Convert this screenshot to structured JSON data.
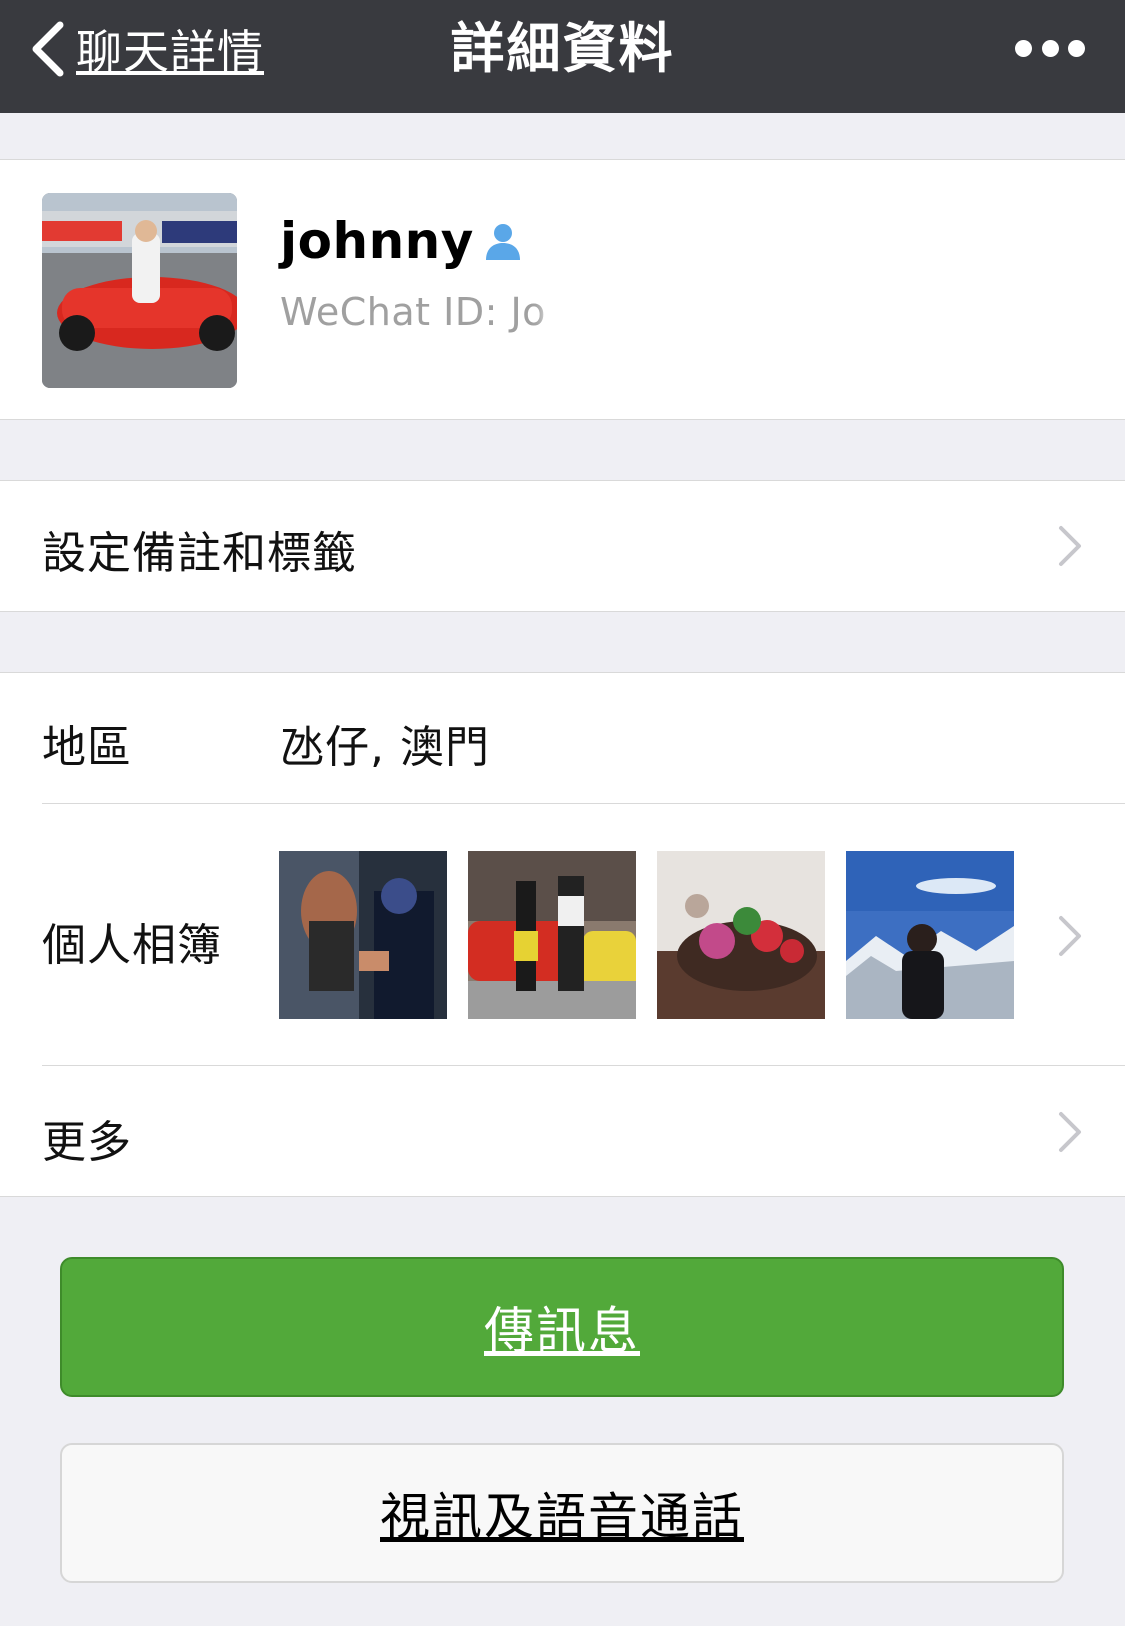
{
  "nav": {
    "back_label": "聊天詳情",
    "title": "詳細資料",
    "more_icon": "more-icon"
  },
  "profile": {
    "name": "johnny",
    "wechat_id_label": "WeChat ID: Jo",
    "name_icon": "person-icon",
    "name_icon_color": "#5aa7e8"
  },
  "remark": {
    "label": "設定備註和標籤"
  },
  "info": {
    "region_label": "地區",
    "region_value": "氹仔, 澳門",
    "album_label": "個人相簿",
    "more_label": "更多"
  },
  "buttons": {
    "message": "傳訊息",
    "call": "視訊及語音通話"
  },
  "colors": {
    "navbar": "#393a3f",
    "primary_button": "#52a93a",
    "background": "#efeff4"
  }
}
